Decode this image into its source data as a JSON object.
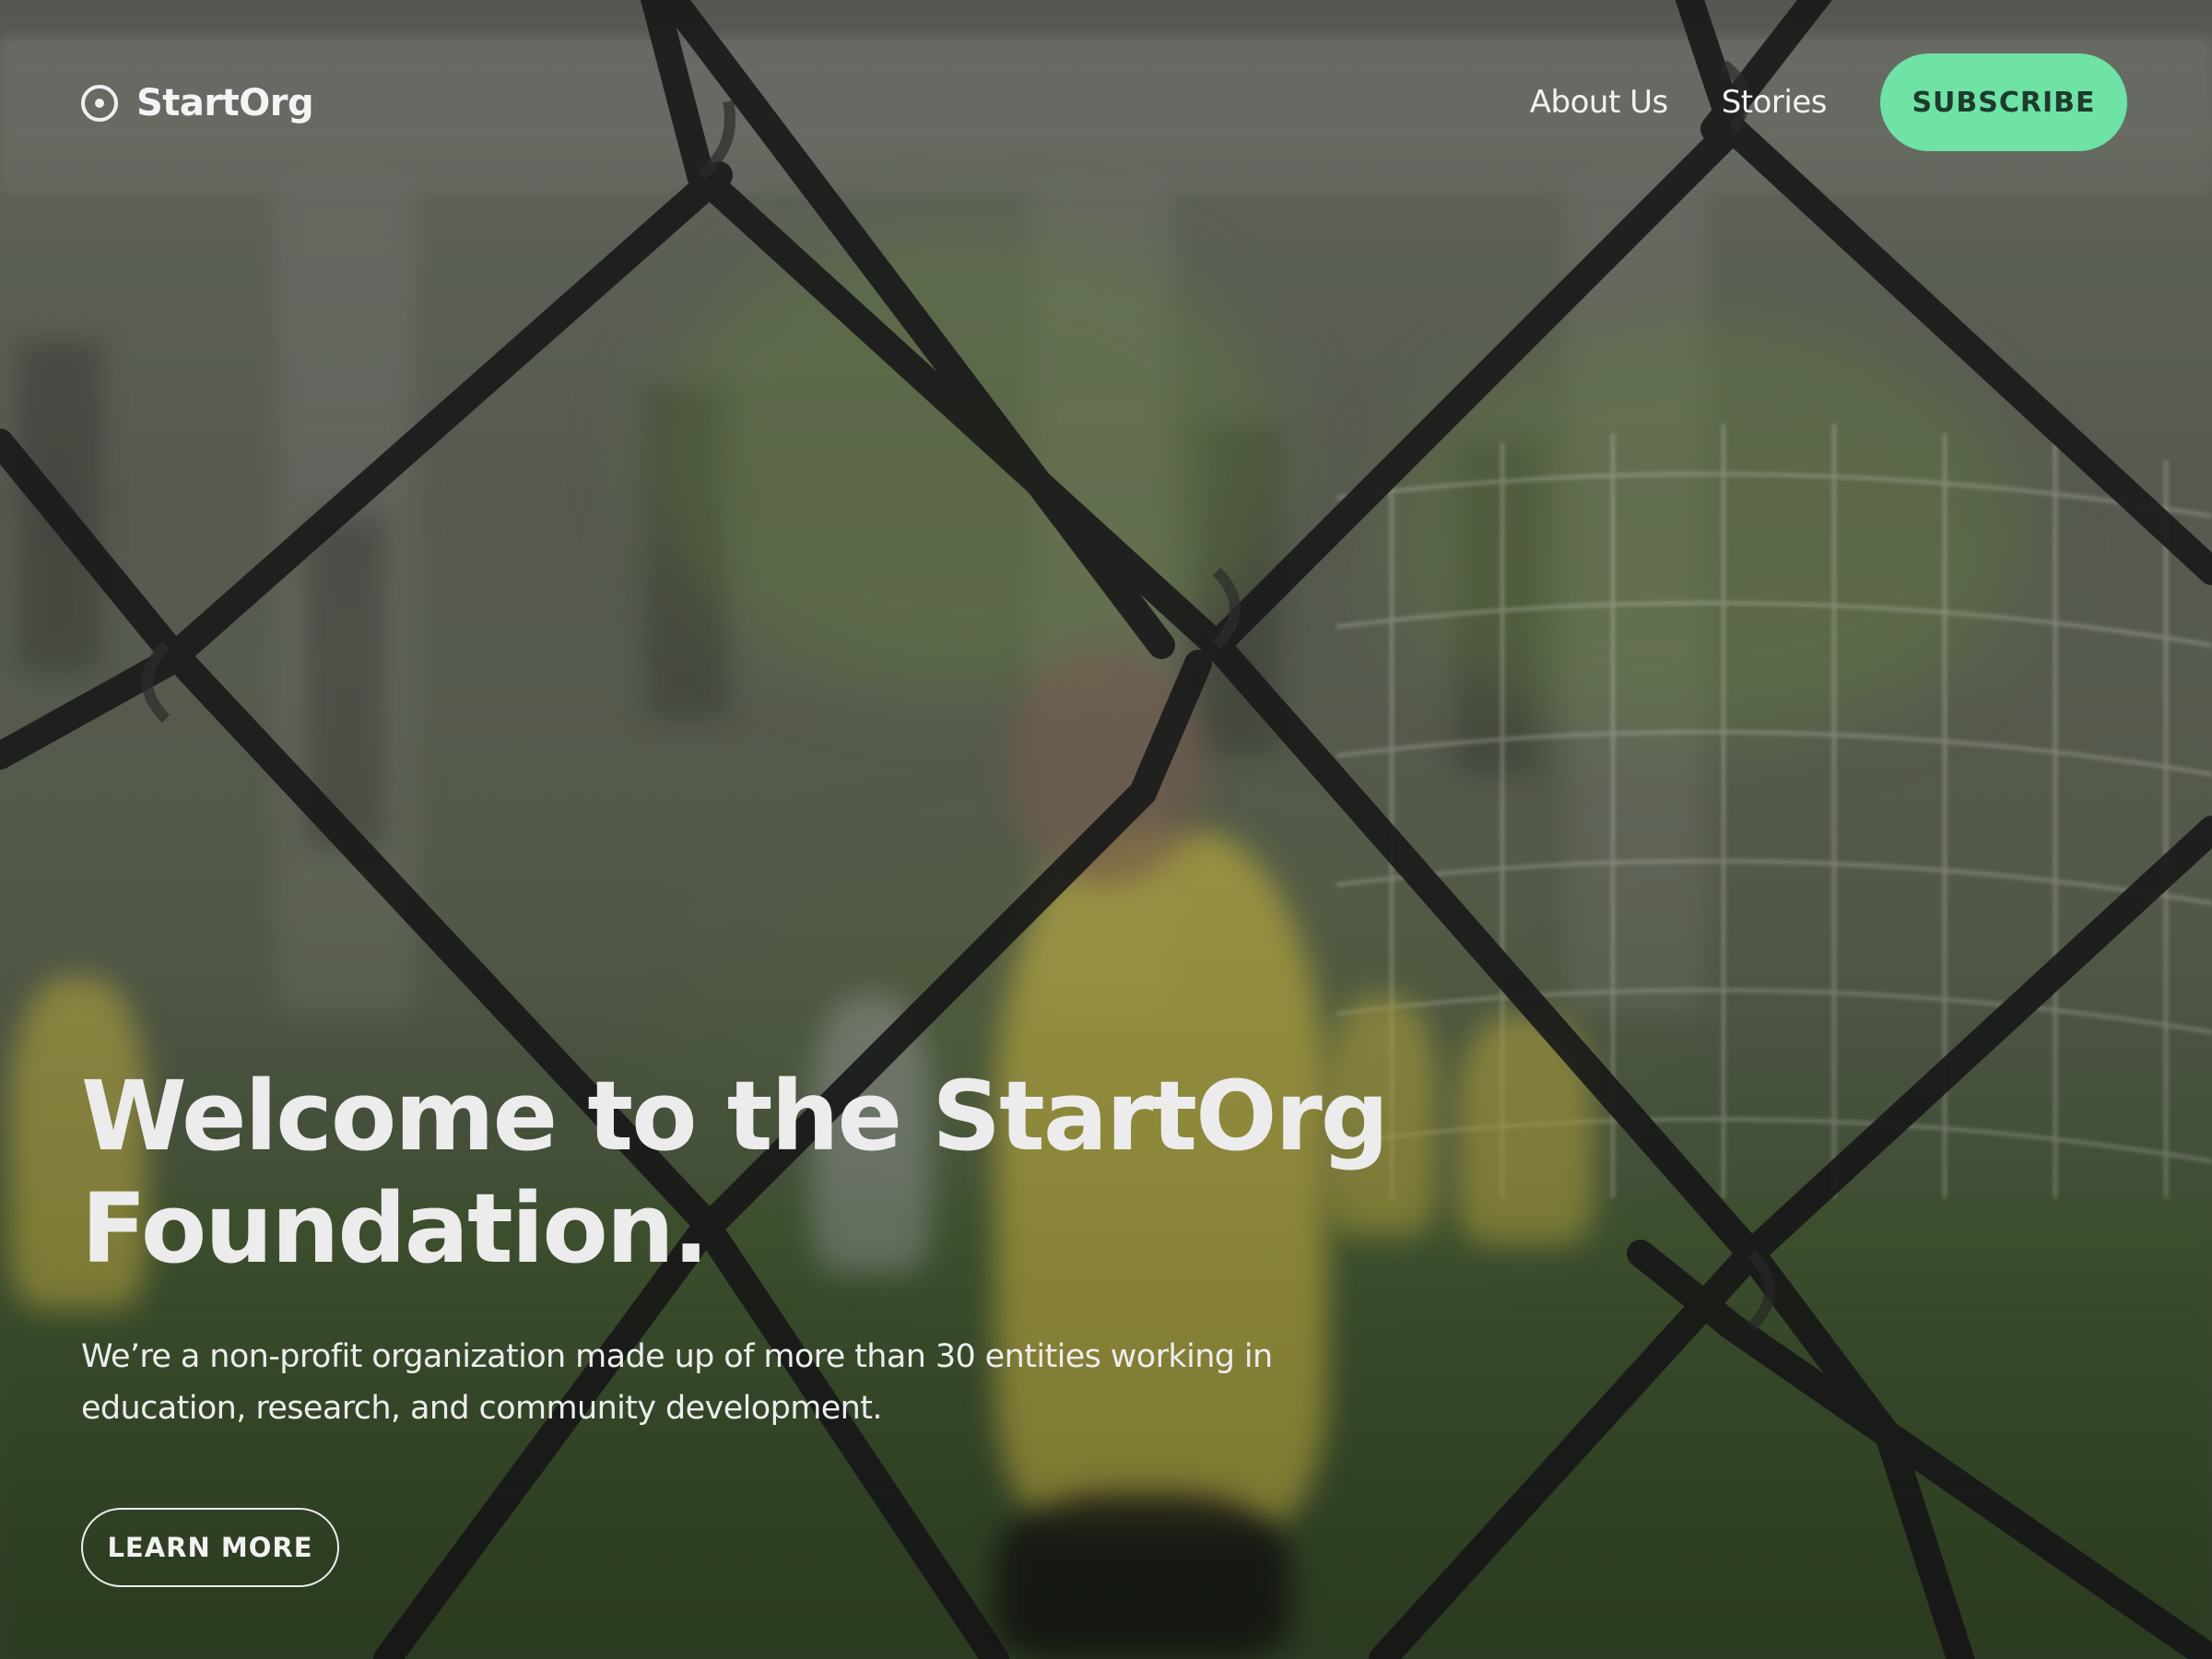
{
  "brand": {
    "name": "StartOrg",
    "icon": "target-circle-icon"
  },
  "nav": {
    "links": [
      {
        "label": "About Us"
      },
      {
        "label": "Stories"
      }
    ],
    "subscribe_label": "SUBSCRIBE"
  },
  "hero": {
    "title_line1": "Welcome to the StartOrg",
    "title_line2": "Foundation.",
    "description": "We’re a non-profit organization made up of more than 30 entities working in education, research, and community development.",
    "cta_label": "LEARN MORE"
  },
  "colors": {
    "accent": "#6fe2a6",
    "accent_text": "#1d3a2c",
    "text": "#ececec"
  }
}
